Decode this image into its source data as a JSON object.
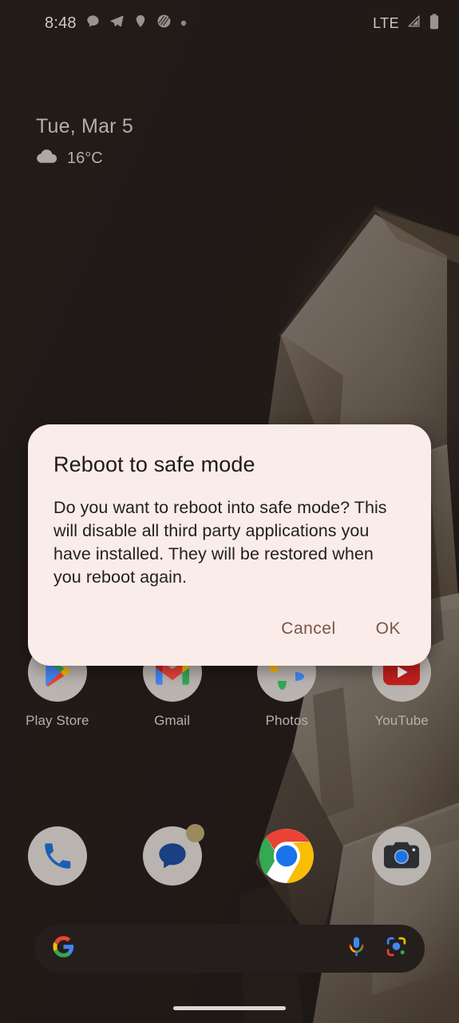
{
  "status_bar": {
    "time": "8:48",
    "network_label": "LTE",
    "notification_icons": [
      {
        "name": "chat-bubble-icon"
      },
      {
        "name": "telegram-send-icon"
      },
      {
        "name": "location-pin-icon"
      },
      {
        "name": "stripes-app-icon"
      },
      {
        "name": "more-notifications-dot-icon"
      }
    ],
    "right_icons": [
      {
        "name": "signal-strength-icon"
      },
      {
        "name": "battery-icon"
      }
    ]
  },
  "glance_widget": {
    "date": "Tue, Mar 5",
    "temperature": "16°C",
    "weather_icon": "cloud-icon"
  },
  "home_screen": {
    "app_rows": [
      {
        "row": 1,
        "show_labels": true,
        "apps": [
          {
            "label": "Play Store",
            "icon": "play-store-icon",
            "circle_bg": true,
            "badge": false
          },
          {
            "label": "Gmail",
            "icon": "gmail-icon",
            "circle_bg": true,
            "badge": true
          },
          {
            "label": "Photos",
            "icon": "google-photos-icon",
            "circle_bg": true,
            "badge": false
          },
          {
            "label": "YouTube",
            "icon": "youtube-icon",
            "circle_bg": true,
            "badge": false
          }
        ]
      },
      {
        "row": 2,
        "show_labels": false,
        "apps": [
          {
            "label": "Phone",
            "icon": "phone-icon",
            "circle_bg": true,
            "badge": false
          },
          {
            "label": "Messages",
            "icon": "messages-icon",
            "circle_bg": true,
            "badge": true
          },
          {
            "label": "Chrome",
            "icon": "chrome-icon",
            "circle_bg": false,
            "badge": false
          },
          {
            "label": "Camera",
            "icon": "camera-icon",
            "circle_bg": true,
            "badge": false
          }
        ]
      }
    ],
    "search_bar": {
      "placeholder": "",
      "value": "",
      "logo_icon": "google-g-icon",
      "mic_icon": "microphone-icon",
      "lens_icon": "google-lens-icon"
    },
    "home_gesture_bar": "home-gesture-bar"
  },
  "dialog": {
    "title": "Reboot to safe mode",
    "message": "Do you want to reboot into safe mode? This will disable all third party applications you have installed. They will be restored when you reboot again.",
    "cancel_label": "Cancel",
    "ok_label": "OK"
  },
  "colors": {
    "dialog_background": "#faece8",
    "dialog_button_text": "#7a5449",
    "wallpaper_base": "#2d2624",
    "status_text": "#cfc9c5",
    "app_label_text": "#b7b0ac",
    "search_bar_background": "#241f1d"
  }
}
